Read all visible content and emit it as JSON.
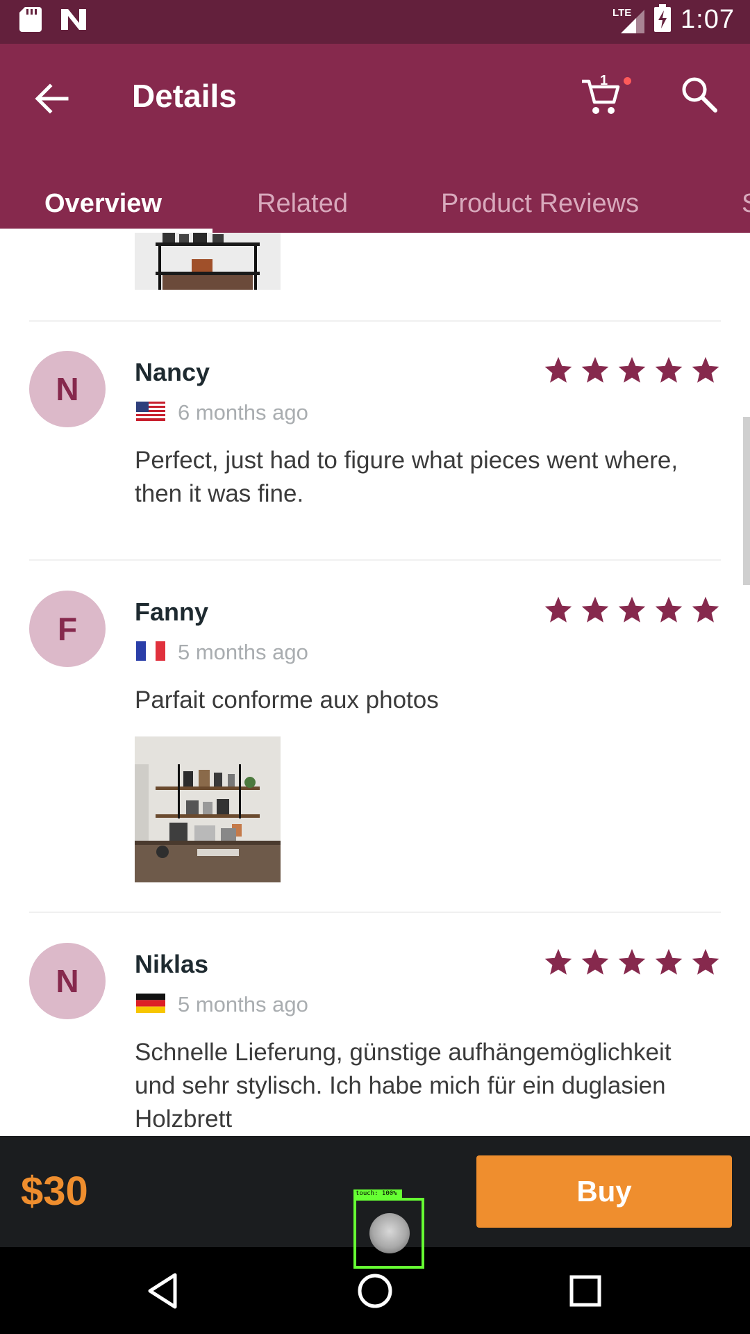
{
  "status_bar": {
    "network": "LTE",
    "time": "1:07"
  },
  "app_bar": {
    "title": "Details",
    "cart_count": "1"
  },
  "tabs": [
    {
      "label": "Overview",
      "active": true
    },
    {
      "label": "Related",
      "active": false
    },
    {
      "label": "Product Reviews",
      "active": false
    },
    {
      "label": "S",
      "active": false
    }
  ],
  "reviews": [
    {
      "initial": "N",
      "name": "Nancy",
      "country_flag": "us-flag",
      "date": "6 months ago",
      "rating": 5,
      "text": "Perfect, just had to figure what pieces went where, then it was fine."
    },
    {
      "initial": "F",
      "name": "Fanny",
      "country_flag": "fr-flag",
      "date": "5 months ago",
      "rating": 5,
      "text": "Parfait conforme aux photos"
    },
    {
      "initial": "N",
      "name": "Niklas",
      "country_flag": "de-flag",
      "date": "5 months ago",
      "rating": 5,
      "text": "Schnelle Lieferung, günstige aufhängemöglichkeit und sehr stylisch. Ich habe mich für ein duglasien Holzbrett"
    }
  ],
  "bottom_bar": {
    "price": "$30",
    "buy_label": "Buy"
  },
  "touch_overlay": {
    "label": "touch: 100%"
  },
  "colors": {
    "status_bar": "#63203c",
    "primary": "#86294d",
    "accent": "#ef8e2e",
    "avatar_bg": "#dcb9c9",
    "bottom_bar": "#1b1d1f"
  }
}
